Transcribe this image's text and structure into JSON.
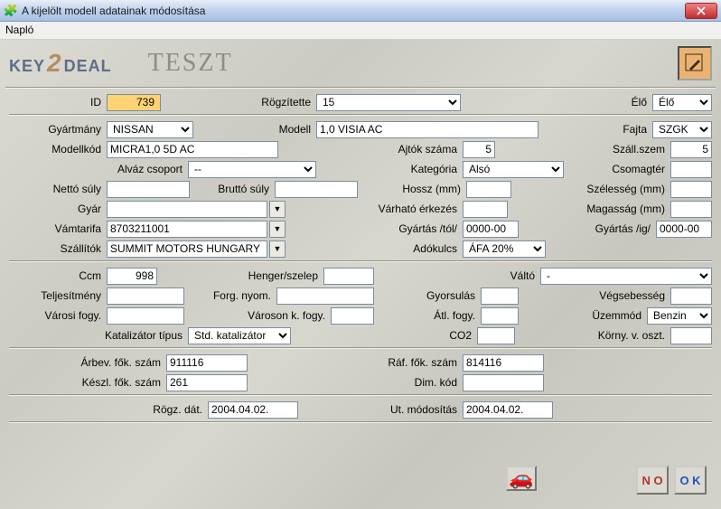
{
  "window": {
    "title": "A kijelölt modell adatainak módosítása",
    "menu_log": "Napló"
  },
  "header": {
    "logo_left": "KEY",
    "logo_mid": "2",
    "logo_right": "DEAL",
    "brand": "TESZT"
  },
  "r1": {
    "id_lbl": "ID",
    "id_val": "739",
    "rogz_lbl": "Rögzítette",
    "rogz_val": "15",
    "elo_lbl": "Élő",
    "elo_val": "Élő"
  },
  "r2": {
    "gyart_lbl": "Gyártmány",
    "gyart_val": "NISSAN",
    "modell_lbl": "Modell",
    "modell_val": "1,0 VISIA AC",
    "fajta_lbl": "Fajta",
    "fajta_val": "SZGK"
  },
  "r3": {
    "mkod_lbl": "Modellkód",
    "mkod_val": "MICRA1,0 5D AC",
    "ajtok_lbl": "Ajtók száma",
    "ajtok_val": "5",
    "szall_lbl": "Száll.szem",
    "szall_val": "5"
  },
  "r4": {
    "alvaz_lbl": "Alváz csoport",
    "alvaz_val": "--",
    "kat_lbl": "Kategória",
    "kat_val": "Alsó",
    "csomag_lbl": "Csomagtér",
    "csomag_val": ""
  },
  "r5": {
    "netto_lbl": "Nettó súly",
    "netto_val": "",
    "brutto_lbl": "Bruttó súly",
    "brutto_val": "",
    "hossz_lbl": "Hossz (mm)",
    "hossz_val": "",
    "szel_lbl": "Szélesség (mm)",
    "szel_val": ""
  },
  "r6": {
    "gyar_lbl": "Gyár",
    "gyar_val": "",
    "vark_lbl": "Várható érkezés",
    "vark_val": "",
    "mag_lbl": "Magasság (mm)",
    "mag_val": ""
  },
  "r7": {
    "vam_lbl": "Vámtarifa",
    "vam_val": "8703211001",
    "gytol_lbl": "Gyártás /tól/",
    "gytol_val": "0000-00",
    "gyig_lbl": "Gyártás /ig/",
    "gyig_val": "0000-00"
  },
  "r8": {
    "szallitok_lbl": "Szállítók",
    "szallitok_val": "SUMMIT MOTORS HUNGARY",
    "ado_lbl": "Adókulcs",
    "ado_val": "ÁFA 20%"
  },
  "r9": {
    "ccm_lbl": "Ccm",
    "ccm_val": "998",
    "heng_lbl": "Henger/szelep",
    "heng_val": "",
    "valto_lbl": "Váltó",
    "valto_val": "-"
  },
  "r10": {
    "tel_lbl": "Teljesítmény",
    "tel_val": "",
    "forg_lbl": "Forg. nyom.",
    "forg_val": "",
    "gyors_lbl": "Gyorsulás",
    "gyors_val": "",
    "veg_lbl": "Végsebesség",
    "veg_val": ""
  },
  "r11": {
    "vfogy_lbl": "Városi  fogy.",
    "vfogy_val": "",
    "vkfogy_lbl": "Városon k. fogy.",
    "vkfogy_val": "",
    "atl_lbl": "Átl. fogy.",
    "atl_val": "",
    "uzem_lbl": "Üzemmód",
    "uzem_val": "Benzin"
  },
  "r12": {
    "kat_lbl": "Katalizátor típus",
    "kat_val": "Std. katalizátor",
    "co2_lbl": "CO2",
    "co2_val": "",
    "korny_lbl": "Körny. v. oszt.",
    "korny_val": ""
  },
  "r13": {
    "arb_lbl": "Árbev. fők. szám",
    "arb_val": "911116",
    "raf_lbl": "Ráf. fők. szám",
    "raf_val": "814116"
  },
  "r14": {
    "keszl_lbl": "Készl. fők. szám",
    "keszl_val": "261",
    "dim_lbl": "Dim. kód",
    "dim_val": ""
  },
  "r15": {
    "rogzdat_lbl": "Rögz. dát.",
    "rogzdat_val": "2004.04.02.",
    "utmod_lbl": "Ut. módosítás",
    "utmod_val": "2004.04.02."
  },
  "btns": {
    "no": "N O",
    "ok": "O K"
  }
}
